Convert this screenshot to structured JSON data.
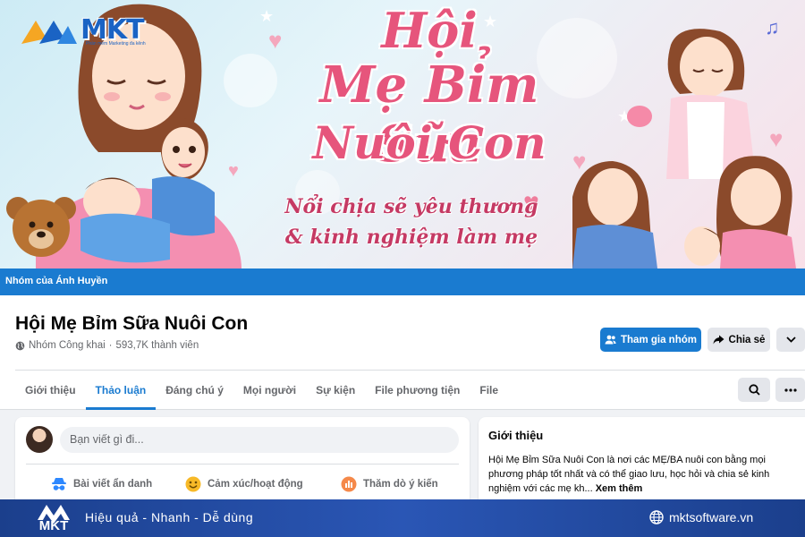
{
  "cover": {
    "title_line1": "Hội",
    "title_line2": "Mẹ Bỉm Sữa",
    "title_line3": "Nuôi Con",
    "subtitle_line1": "Nổi chịa sẽ yêu thương",
    "subtitle_line2": "& kinh nghiệm làm mẹ",
    "logo_text": "MKT",
    "logo_tagline": "Phần mềm Marketing đa kênh"
  },
  "owner_bar": {
    "label": "Nhóm của Ánh Huyền"
  },
  "group": {
    "name": "Hội Mẹ Bỉm Sữa Nuôi Con",
    "privacy": "Nhóm Công khai",
    "separator": "·",
    "members": "593,7K thành viên"
  },
  "buttons": {
    "join": "Tham gia nhóm",
    "share": "Chia sẻ"
  },
  "tabs": [
    {
      "label": "Giới thiệu",
      "active": false
    },
    {
      "label": "Thảo luận",
      "active": true
    },
    {
      "label": "Đáng chú ý",
      "active": false
    },
    {
      "label": "Mọi người",
      "active": false
    },
    {
      "label": "Sự kiện",
      "active": false
    },
    {
      "label": "File phương tiện",
      "active": false
    },
    {
      "label": "File",
      "active": false
    }
  ],
  "composer": {
    "placeholder": "Bạn viết gì đi...",
    "actions": [
      {
        "label": "Bài viết ẩn danh",
        "icon": "anonymous-icon"
      },
      {
        "label": "Cảm xúc/hoạt động",
        "icon": "smiley-icon"
      },
      {
        "label": "Thăm dò ý kiến",
        "icon": "poll-icon"
      }
    ]
  },
  "intro": {
    "title": "Giới thiệu",
    "text": "Hội Mẹ Bỉm Sữa Nuôi Con là nơi các MẸ/BA nuôi con bằng mọi phương pháp tốt nhất và có thể giao lưu, học hỏi và chia sẻ kinh nghiệm với các mẹ kh...",
    "see_more": "Xem thêm"
  },
  "footer": {
    "logo_text": "MKT",
    "slogan": "Hiệu quả - Nhanh - Dễ dùng",
    "website": "mktsoftware.vn"
  },
  "colors": {
    "primary": "#1a7bd0",
    "title_pink": "#e6557c",
    "footer_blue": "#1b3f8c"
  }
}
